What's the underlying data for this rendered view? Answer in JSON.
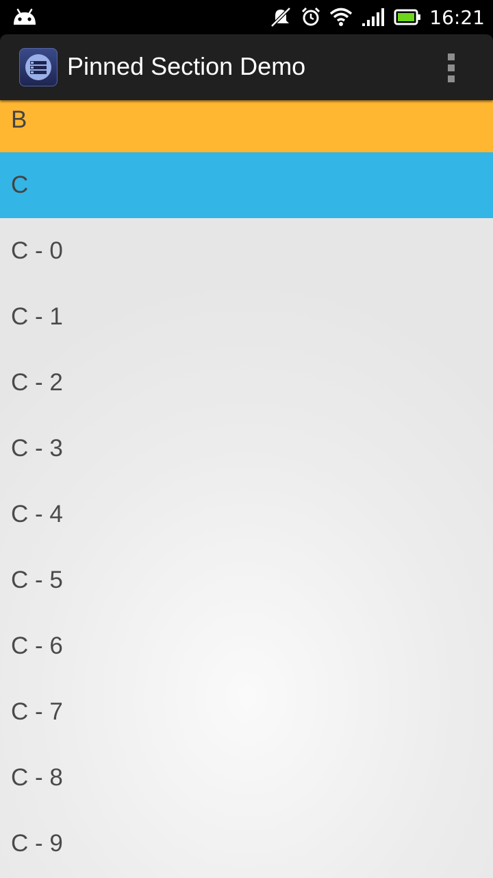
{
  "status_bar": {
    "time": "16:21",
    "icons": [
      "android-debug-icon",
      "notifications-muted-icon",
      "alarm-icon",
      "wifi-icon",
      "signal-icon",
      "battery-icon"
    ],
    "battery_color": "#6fd61c"
  },
  "action_bar": {
    "title": "Pinned Section Demo",
    "app_icon": "pinned-list-app-icon",
    "overflow_icon": "overflow-menu-icon"
  },
  "colors": {
    "section_b": "#ffb731",
    "section_c": "#33b5e5",
    "action_bar": "#202020"
  },
  "sections": {
    "b_label": "B",
    "c_label": "C"
  },
  "items": [
    "C - 0",
    "C - 1",
    "C - 2",
    "C - 3",
    "C - 4",
    "C - 5",
    "C - 6",
    "C - 7",
    "C - 8",
    "C - 9"
  ]
}
